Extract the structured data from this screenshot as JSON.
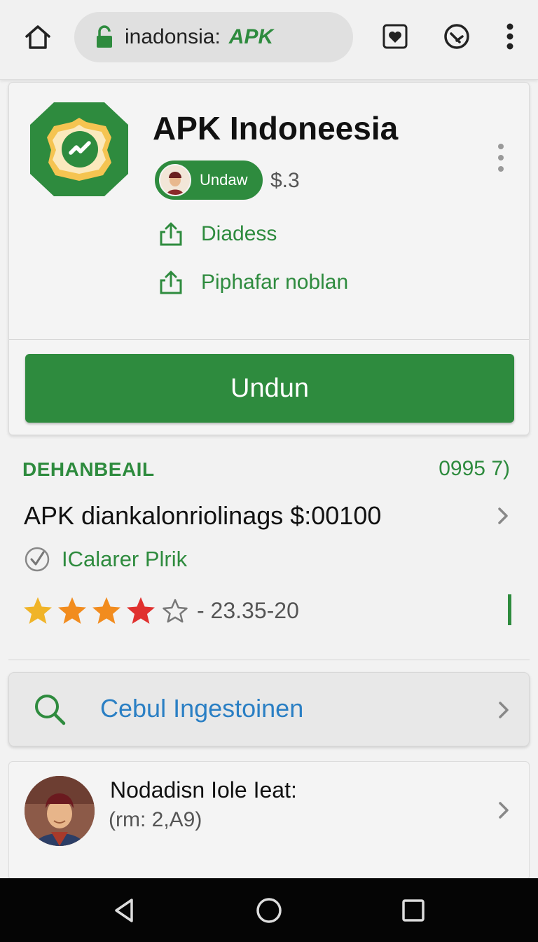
{
  "browser": {
    "url_host": "inadonsia:",
    "url_path": "APK",
    "icons": [
      "home-icon",
      "lock-icon",
      "heart-icon",
      "tabs-icon",
      "more-vert-icon"
    ]
  },
  "app": {
    "title": "APK Indoneesia",
    "developer_chip": "Undaw",
    "price": "$.3",
    "actions": [
      {
        "label": "Diadess",
        "icon": "share-icon"
      },
      {
        "label": "Piphafar noblan",
        "icon": "share-icon"
      }
    ],
    "primary_button": "Undun"
  },
  "details": {
    "section_label": "DEHANBEAIL",
    "section_count": "0995 7)",
    "info_text": "APK diankalonriolinags $:00100",
    "check_label": "ICalarer Plrik",
    "rating": {
      "filled_stars": 4,
      "total_stars": 5,
      "text": "- 23.35-20"
    }
  },
  "search": {
    "text": "Cebul Ingestoinen",
    "icon": "search-icon"
  },
  "profile": {
    "name": "Nodadisn Iole Ieat:",
    "subtitle": "(rm: 2,A9)"
  },
  "colors": {
    "brand_green": "#2e8b3e",
    "link_blue": "#2a7fc4",
    "star_gold": "#f0b429",
    "star_orange": "#f28c1e",
    "star_red": "#e0312f"
  },
  "navbar": {
    "icons": [
      "back-icon",
      "home-circle-icon",
      "recents-icon"
    ]
  }
}
